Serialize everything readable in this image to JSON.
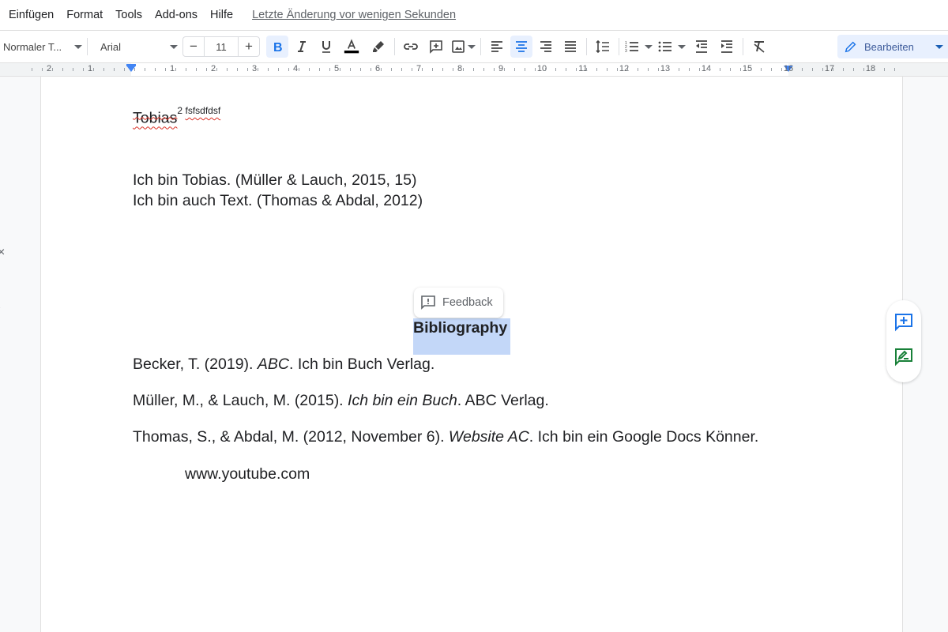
{
  "menubar": {
    "items": [
      "Einfügen",
      "Format",
      "Tools",
      "Add-ons",
      "Hilfe"
    ],
    "last_edit": "Letzte Änderung vor wenigen Sekunden"
  },
  "toolbar": {
    "paragraph_style": "Normaler T...",
    "font": "Arial",
    "font_size": "11",
    "decrease_font_symbol": "−",
    "increase_font_symbol": "+",
    "bold_active": true,
    "align_center_active": true,
    "text_color": "#000000",
    "edit_mode_label": "Bearbeiten",
    "accent_color": "#1a73e8"
  },
  "ruler": {
    "left_labels": [
      "2",
      "1"
    ],
    "right_labels": [
      "1",
      "2",
      "3",
      "4",
      "5",
      "6",
      "7",
      "8",
      "9",
      "10",
      "11",
      "12",
      "13",
      "14",
      "15",
      "16",
      "17",
      "18"
    ]
  },
  "document": {
    "line1_word": "Tobias",
    "line1_sup": "2",
    "line1_footnote": "fsfsdfdsf",
    "para1": "Ich bin Tobias. (Müller & Lauch, 2015, 15)",
    "para2": "Ich bin auch Text. (Thomas & Abdal, 2012)",
    "heading": "Bibliography",
    "refs": [
      {
        "pre": "Becker, T. (2019). ",
        "italic": "ABC",
        "post": ". Ich bin Buch Verlag."
      },
      {
        "pre": "Müller, M., & Lauch, M. (2015). ",
        "italic": "Ich bin ein Buch",
        "post": ". ABC Verlag."
      },
      {
        "pre": "Thomas, S., & Abdal, M. (2012, November 6). ",
        "italic": "Website AC",
        "post": ". Ich bin ein Google Docs Könner."
      }
    ],
    "url_line": "www.youtube.com"
  },
  "feedback": {
    "label": "Feedback"
  },
  "side_actions": {
    "add_comment_color": "#1a73e8",
    "suggest_edit_color": "#188038"
  }
}
